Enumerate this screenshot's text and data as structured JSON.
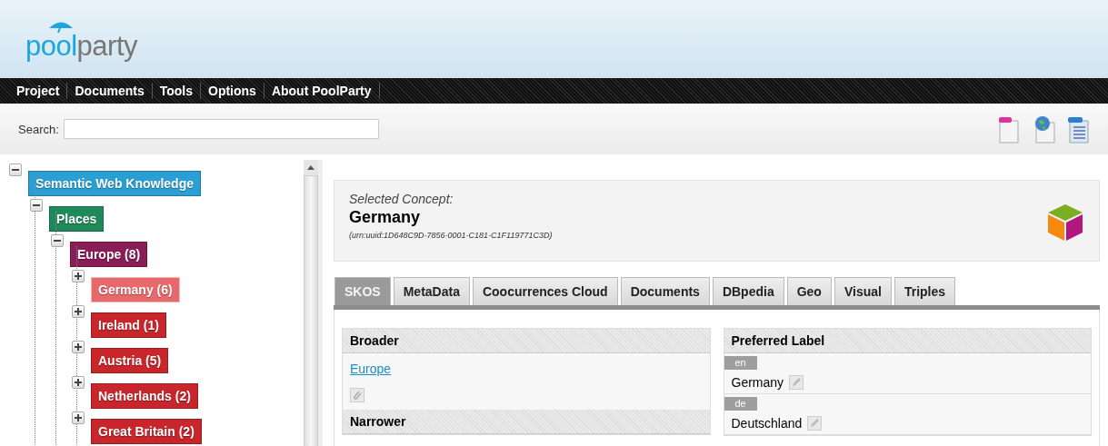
{
  "logo": {
    "part_1": "pool",
    "part_2": "party"
  },
  "menu": [
    {
      "label": "Project"
    },
    {
      "label": "Documents"
    },
    {
      "label": "Tools"
    },
    {
      "label": "Options"
    },
    {
      "label": "About PoolParty"
    }
  ],
  "search": {
    "label": "Search:"
  },
  "toolbar": [
    {
      "kind": "document"
    },
    {
      "kind": "web"
    },
    {
      "kind": "text"
    }
  ],
  "tree": [
    {
      "label": "Semantic Web Knowledge",
      "color": "#2b9fd4",
      "expanded": true,
      "selected": false,
      "children": [
        {
          "label": "Places",
          "color": "#1e8a5a",
          "expanded": true,
          "selected": false,
          "children": [
            {
              "label": "Europe (8)",
              "color": "#8a1d58",
              "expanded": true,
              "selected": false,
              "children": [
                {
                  "label": "Germany (6)",
                  "color": "#e8696b",
                  "expanded": false,
                  "selected": true
                },
                {
                  "label": "Ireland (1)",
                  "color": "#c9262b",
                  "expanded": false,
                  "selected": false
                },
                {
                  "label": "Austria (5)",
                  "color": "#c9262b",
                  "expanded": false,
                  "selected": false
                },
                {
                  "label": "Netherlands (2)",
                  "color": "#c9262b",
                  "expanded": false,
                  "selected": false
                },
                {
                  "label": "Great Britain (2)",
                  "color": "#c9262b",
                  "expanded": false,
                  "selected": false
                }
              ]
            }
          ]
        }
      ]
    }
  ],
  "concept": {
    "caption": "Selected Concept:",
    "name": "Germany",
    "uri": "(urn:uuid:1D648C9D-7856-0001-C181-C1F119771C3D)"
  },
  "tabs": [
    {
      "label": "SKOS",
      "selected": true
    },
    {
      "label": "MetaData",
      "selected": false
    },
    {
      "label": "Coocurrences Cloud",
      "selected": false
    },
    {
      "label": "Documents",
      "selected": false
    },
    {
      "label": "DBpedia",
      "selected": false
    },
    {
      "label": "Geo",
      "selected": false
    },
    {
      "label": "Visual",
      "selected": false
    },
    {
      "label": "Triples",
      "selected": false
    }
  ],
  "broader": {
    "title": "Broader",
    "links": [
      "Europe"
    ]
  },
  "narrower": {
    "title": "Narrower"
  },
  "preferred_label": {
    "title": "Preferred Label",
    "labels": [
      {
        "lang": "en",
        "value": "Germany"
      },
      {
        "lang": "de",
        "value": "Deutschland"
      }
    ]
  }
}
